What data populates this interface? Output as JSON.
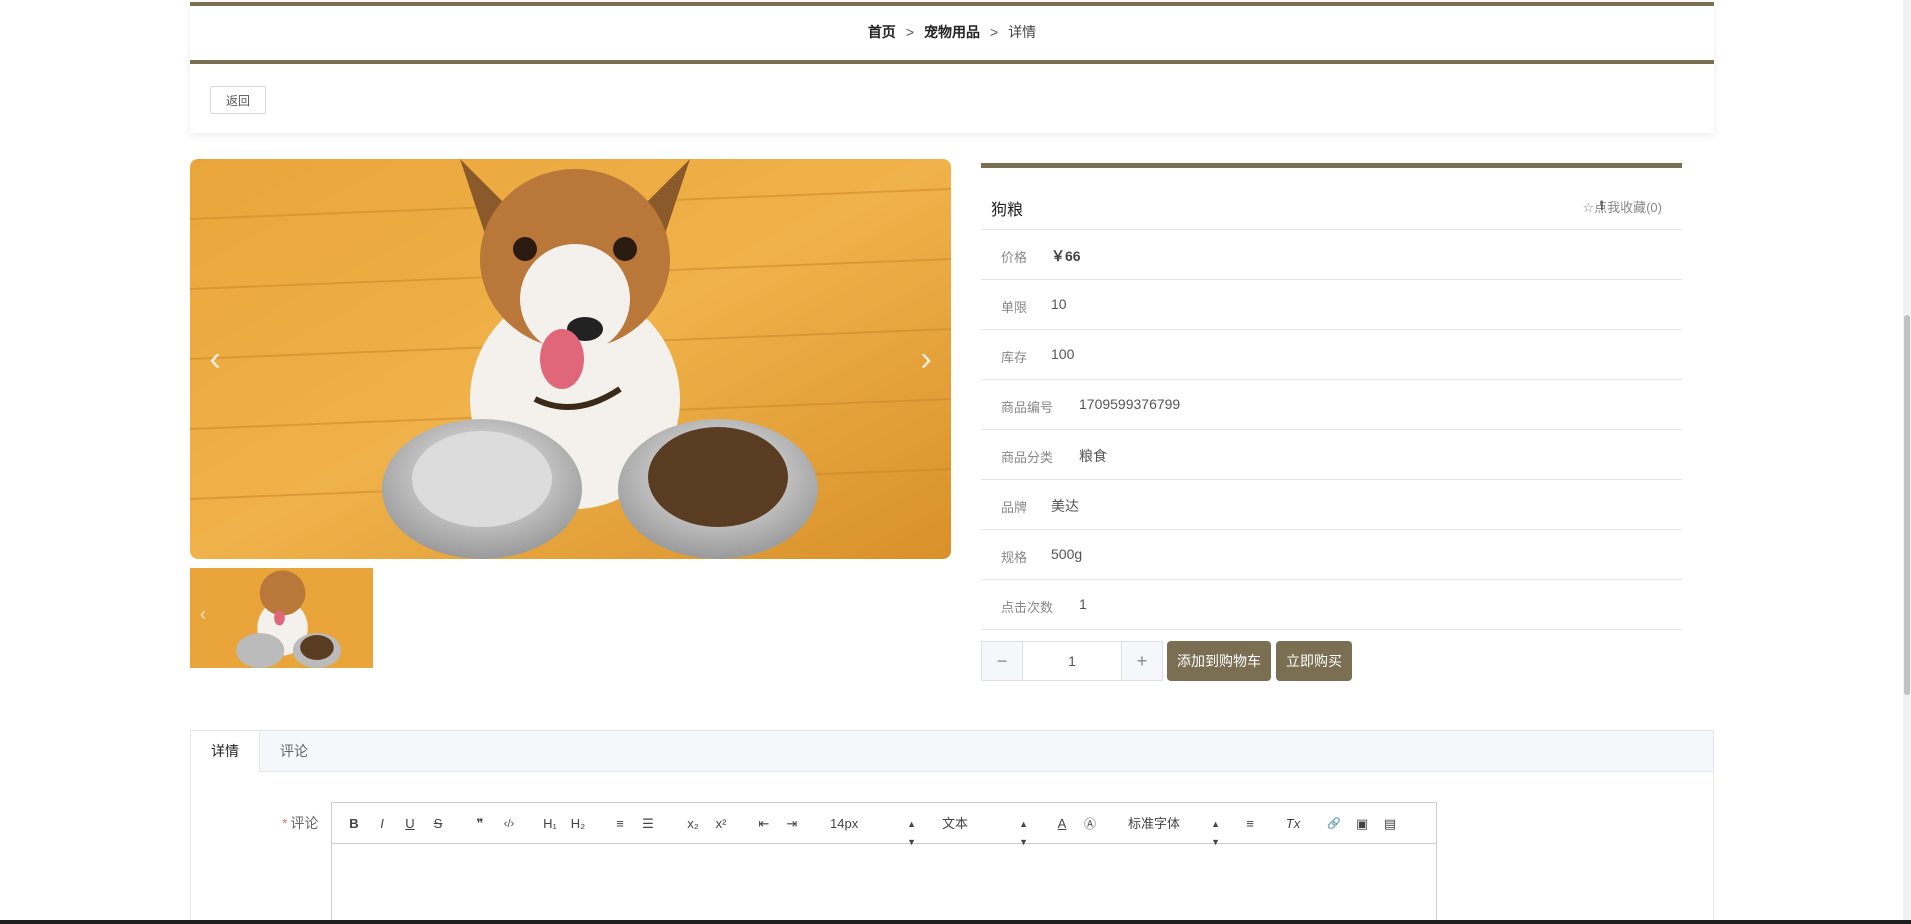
{
  "breadcrumb": {
    "home": "首页",
    "category": "宠物用品",
    "current": "详情",
    "sep": ">"
  },
  "back_label": "返回",
  "gallery": {
    "prev_icon": "‹",
    "next_icon": "›"
  },
  "product": {
    "title": "狗粮",
    "favorite": "☆点我收藏(0)",
    "rows": [
      {
        "label": "价格",
        "value": "￥66"
      },
      {
        "label": "单限",
        "value": "10"
      },
      {
        "label": "库存",
        "value": "100"
      },
      {
        "label": "商品编号",
        "value": "1709599376799"
      },
      {
        "label": "商品分类",
        "value": "粮食"
      },
      {
        "label": "品牌",
        "value": "美达"
      },
      {
        "label": "规格",
        "value": "500g"
      },
      {
        "label": "点击次数",
        "value": "1"
      }
    ]
  },
  "quantity": {
    "minus": "−",
    "value": "1",
    "plus": "+"
  },
  "actions": {
    "add_to_cart": "添加到购物车",
    "buy_now": "立即购买"
  },
  "tabs": [
    {
      "label": "详情"
    },
    {
      "label": "评论"
    }
  ],
  "comment": {
    "required_mark": "*",
    "label": "评论",
    "toolbar": {
      "bold": "B",
      "italic": "I",
      "underline": "U",
      "strike": "S",
      "quote": "❞",
      "code": "‹/›",
      "h1": "H₁",
      "h2": "H₂",
      "ordered": "≡",
      "bullet": "☰",
      "sub": "x₂",
      "sup": "x²",
      "outdent": "⇤",
      "indent": "⇥",
      "size": "14px",
      "header": "文本",
      "font": "标准字体",
      "color": "A",
      "background": "Ⓐ",
      "align": "≡",
      "clean": "Tx",
      "link": "🔗",
      "image": "▣",
      "video": "▤"
    }
  },
  "colors": {
    "accent": "#7a6e53"
  }
}
